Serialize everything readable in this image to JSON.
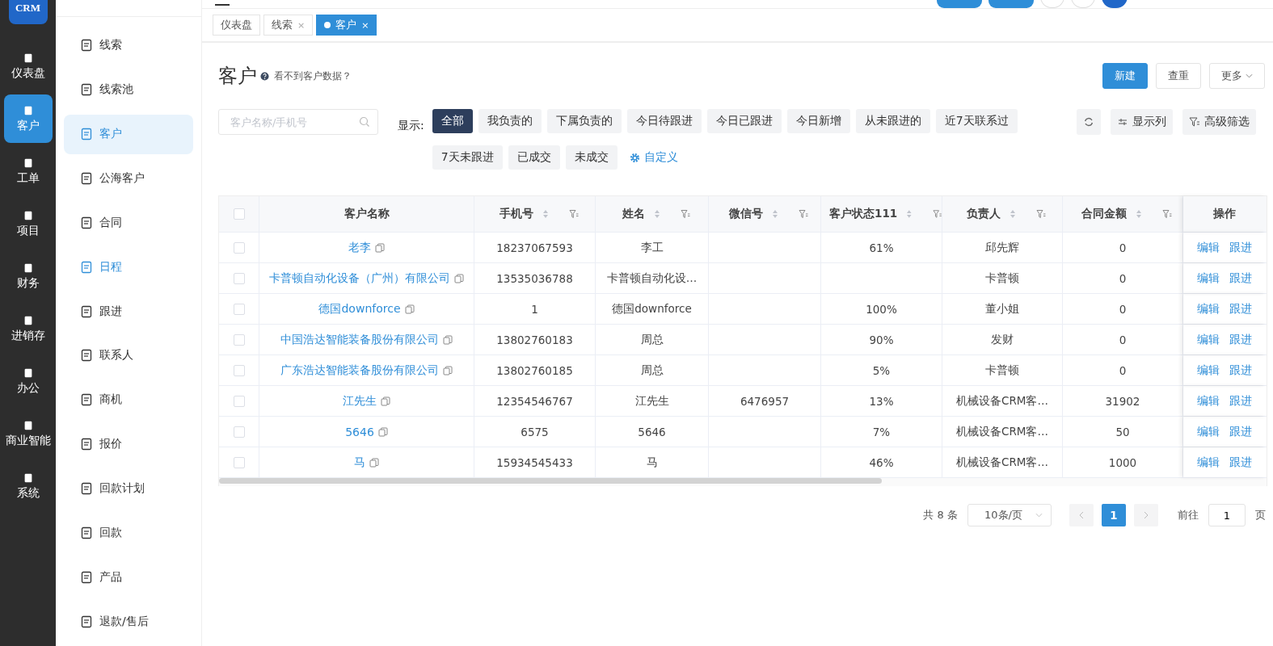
{
  "logo": {
    "text": "CRM"
  },
  "rail": [
    {
      "label": "仪表盘",
      "selected": false
    },
    {
      "label": "客户",
      "selected": true
    },
    {
      "label": "工单",
      "selected": false
    },
    {
      "label": "项目",
      "selected": false
    },
    {
      "label": "财务",
      "selected": false
    },
    {
      "label": "进销存",
      "selected": false
    },
    {
      "label": "办公",
      "selected": false
    },
    {
      "label": "商业智能",
      "selected": false
    },
    {
      "label": "系统",
      "selected": false
    }
  ],
  "sidebar": {
    "items": [
      {
        "label": "线索",
        "selected": false
      },
      {
        "label": "线索池",
        "selected": false
      },
      {
        "label": "客户",
        "selected": true
      },
      {
        "label": "公海客户",
        "selected": false
      },
      {
        "label": "合同",
        "selected": false
      },
      {
        "label": "日程",
        "selected": false,
        "hover": true
      },
      {
        "label": "跟进",
        "selected": false
      },
      {
        "label": "联系人",
        "selected": false
      },
      {
        "label": "商机",
        "selected": false
      },
      {
        "label": "报价",
        "selected": false
      },
      {
        "label": "回款计划",
        "selected": false
      },
      {
        "label": "回款",
        "selected": false
      },
      {
        "label": "产品",
        "selected": false
      },
      {
        "label": "退款/售后",
        "selected": false
      }
    ]
  },
  "tabs": [
    {
      "label": "仪表盘",
      "selected": false,
      "closable": false
    },
    {
      "label": "线索",
      "selected": false,
      "closable": true
    },
    {
      "label": "客户",
      "selected": true,
      "closable": true
    }
  ],
  "tab_close": "×",
  "page": {
    "title": "客户",
    "help": "看不到客户数据？",
    "actions": [
      "新建",
      "查重"
    ],
    "more": "更多"
  },
  "search": {
    "placeholder": "客户名称/手机号"
  },
  "filter_label": "显示:",
  "filters": [
    {
      "label": "全部",
      "selected": true
    },
    {
      "label": "我负责的",
      "selected": false
    },
    {
      "label": "下属负责的",
      "selected": false
    },
    {
      "label": "今日待跟进",
      "selected": false
    },
    {
      "label": "今日已跟进",
      "selected": false
    },
    {
      "label": "今日新增",
      "selected": false
    },
    {
      "label": "从未跟进的",
      "selected": false
    },
    {
      "label": "近7天联系过",
      "selected": false
    },
    {
      "label": "7天未跟进",
      "selected": false
    },
    {
      "label": "已成交",
      "selected": false
    },
    {
      "label": "未成交",
      "selected": false
    }
  ],
  "custom": "自定义",
  "tools": [
    "显示列",
    "高级筛选"
  ],
  "table": {
    "header_checked": false,
    "columns": [
      {
        "label": "客户名称",
        "sortable": false
      },
      {
        "label": "手机号",
        "sortable": true
      },
      {
        "label": "姓名",
        "sortable": true
      },
      {
        "label": "微信号",
        "sortable": true
      },
      {
        "label": "客户状态111",
        "sortable": true
      },
      {
        "label": "负责人",
        "sortable": true
      },
      {
        "label": "合同金额",
        "sortable": true
      }
    ],
    "actions_label": "操作",
    "rows": [
      {
        "checked": false,
        "cells": [
          "老李",
          "18237067593",
          "李工",
          null,
          "61%",
          "邱先辉",
          "0"
        ],
        "actions": [
          "编辑",
          "跟进"
        ]
      },
      {
        "checked": false,
        "cells": [
          "卡普顿自动化设备（广州）有限公司",
          "13535036788",
          "卡普顿自动化设…",
          null,
          null,
          "卡普顿",
          "0"
        ],
        "actions": [
          "编辑",
          "跟进"
        ]
      },
      {
        "checked": false,
        "cells": [
          "德国downforce",
          "1",
          "德国downforce",
          null,
          "100%",
          "董小姐",
          "0"
        ],
        "actions": [
          "编辑",
          "跟进"
        ]
      },
      {
        "checked": false,
        "cells": [
          "中国浩达智能装备股份有限公司",
          "13802760183",
          "周总",
          null,
          "90%",
          "发财",
          "0"
        ],
        "actions": [
          "编辑",
          "跟进"
        ]
      },
      {
        "checked": false,
        "cells": [
          "广东浩达智能装备股份有限公司",
          "13802760185",
          "周总",
          null,
          "5%",
          "卡普顿",
          "0"
        ],
        "actions": [
          "编辑",
          "跟进"
        ]
      },
      {
        "checked": false,
        "cells": [
          "江先生",
          "12354546767",
          "江先生",
          "6476957",
          "13%",
          "机械设备CRM客…",
          "31902"
        ],
        "actions": [
          "编辑",
          "跟进"
        ]
      },
      {
        "checked": false,
        "cells": [
          "5646",
          "6575",
          "5646",
          null,
          "7%",
          "机械设备CRM客…",
          "50"
        ],
        "actions": [
          "编辑",
          "跟进"
        ]
      },
      {
        "checked": false,
        "cells": [
          "马",
          "15934545433",
          "马",
          null,
          "46%",
          "机械设备CRM客…",
          "1000"
        ],
        "actions": [
          "编辑",
          "跟进"
        ]
      }
    ]
  },
  "pagination": {
    "total": "共 8 条",
    "page_size": "10条/页",
    "pages": [
      {
        "label": "1",
        "selected": true
      }
    ],
    "goto_label": "前往",
    "goto_value": "1",
    "goto_suffix": "页"
  }
}
